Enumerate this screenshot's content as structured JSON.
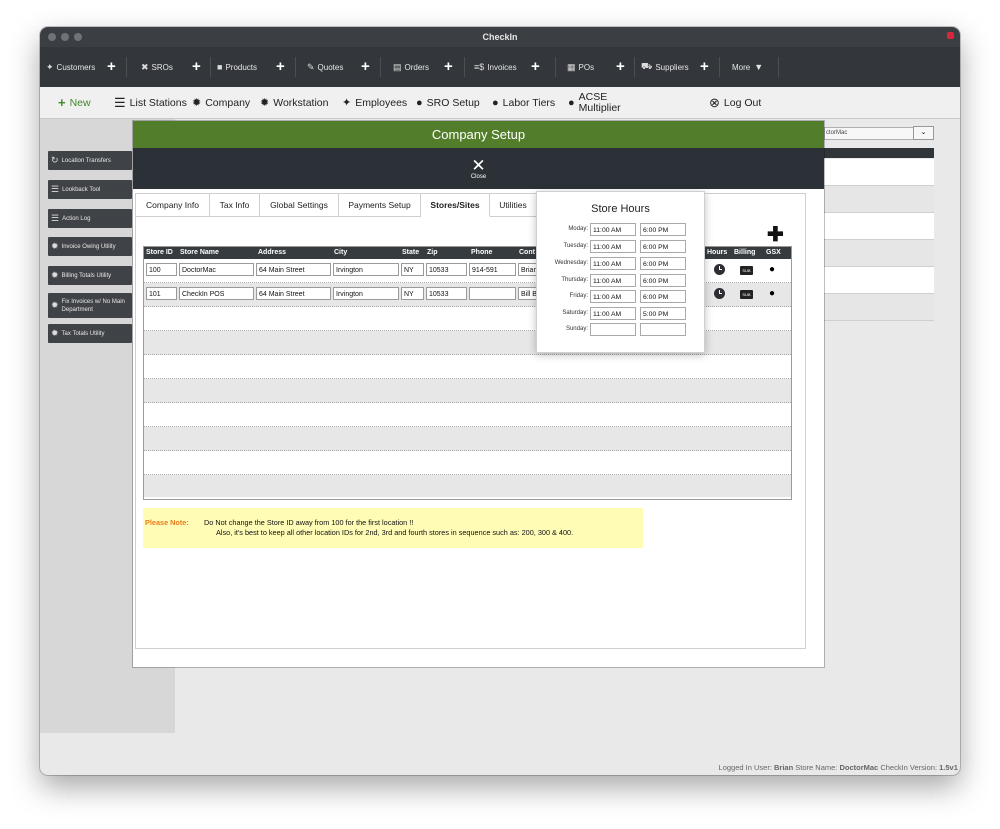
{
  "window": {
    "title": "CheckIn"
  },
  "topnav": [
    {
      "label": "Customers",
      "icon": "users-icon",
      "plus": true
    },
    {
      "label": "SROs",
      "icon": "tools-icon",
      "plus": true
    },
    {
      "label": "Products",
      "icon": "box-icon",
      "plus": true
    },
    {
      "label": "Quotes",
      "icon": "edit-icon",
      "plus": true
    },
    {
      "label": "Orders",
      "icon": "document-icon",
      "plus": true
    },
    {
      "label": "Invoices",
      "icon": "invoice-icon",
      "plus": true
    },
    {
      "label": "POs",
      "icon": "calculator-icon",
      "plus": true
    },
    {
      "label": "Suppliers",
      "icon": "truck-icon",
      "plus": true
    },
    {
      "label": "More",
      "icon": "chevron-down-icon",
      "plus": false
    }
  ],
  "toolbar": {
    "new": "New",
    "list_stations": "List Stations",
    "company": "Company",
    "workstation": "Workstation",
    "employees": "Employees",
    "sro_setup": "SRO Setup",
    "labor_tiers": "Labor Tiers",
    "acse_line1": "ACSE",
    "acse_line2": "Multiplier",
    "logout": "Log Out"
  },
  "sidebar": [
    {
      "label": "Location Transfers",
      "icon": "refresh-icon"
    },
    {
      "label": "Lookback Tool",
      "icon": "menu-icon"
    },
    {
      "label": "Action Log",
      "icon": "menu-icon"
    },
    {
      "label": "Invoice Owing Utility",
      "icon": "gear-icon"
    },
    {
      "label": "Billing Totals Utility",
      "icon": "gear-icon"
    },
    {
      "label": "Fix Invoices w/ No Main",
      "label2": "Department",
      "icon": "gear-icon"
    },
    {
      "label": "Tax Totals Utility",
      "icon": "gear-icon"
    }
  ],
  "right_panel": {
    "store_select": "ctorMac"
  },
  "modal": {
    "title": "Company Setup",
    "close_label": "Close",
    "tabs": [
      "Company Info",
      "Tax Info",
      "Global Settings",
      "Payments Setup",
      "Stores/Sites",
      "Utilities"
    ],
    "active_tab": "Stores/Sites",
    "columns": [
      "Store ID",
      "Store Name",
      "Address",
      "City",
      "State",
      "Zip",
      "Phone",
      "Cont",
      "Hours",
      "Billing",
      "GSX"
    ],
    "stores": [
      {
        "id": "100",
        "name": "DoctorMac",
        "address": "64 Main Street",
        "city": "Irvington",
        "state": "NY",
        "zip": "10533",
        "phone": "914-591",
        "contact": "Brian"
      },
      {
        "id": "101",
        "name": "CheckIn POS",
        "address": "64 Main Street",
        "city": "Irvington",
        "state": "NY",
        "zip": "10533",
        "phone": "",
        "contact": "Bill B"
      }
    ],
    "note_label": "Please Note:",
    "note_line1": "Do Not change the Store ID away from 100 for the first location !!",
    "note_line2": "Also, it's best to keep all other location IDs for 2nd, 3rd and fourth stores in sequence such as:  200, 300 & 400.",
    "billing_icon_text": "SUB"
  },
  "store_hours": {
    "title": "Store Hours",
    "days": [
      {
        "day": "Moday:",
        "open": "11:00 AM",
        "close": "6:00 PM"
      },
      {
        "day": "Tuesday:",
        "open": "11:00 AM",
        "close": "6:00 PM"
      },
      {
        "day": "Wednesday:",
        "open": "11:00 AM",
        "close": "6:00 PM"
      },
      {
        "day": "Thursday:",
        "open": "11:00 AM",
        "close": "6:00 PM"
      },
      {
        "day": "Friday:",
        "open": "11:00 AM",
        "close": "6:00 PM"
      },
      {
        "day": "Saturday:",
        "open": "11:00 AM",
        "close": "5:00 PM"
      },
      {
        "day": "Sunday:",
        "open": "",
        "close": ""
      }
    ]
  },
  "status": {
    "logged_in_label": "Logged In User:",
    "user": "Brian",
    "store_label": "Store Name:",
    "store": "DoctorMac",
    "version_label": "CheckIn Version:",
    "version": "1.5v1"
  }
}
